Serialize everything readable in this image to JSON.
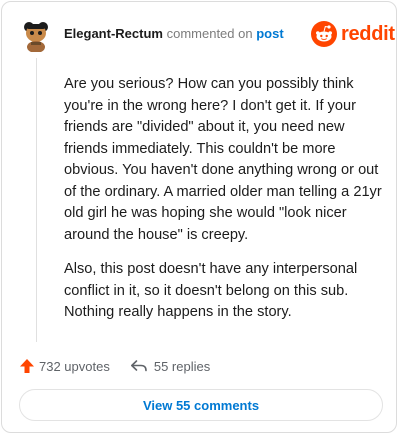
{
  "comment": {
    "username": "Elegant-Rectum",
    "action_text": "commented on",
    "post_link_text": "post",
    "paragraphs": [
      "Are you serious? How can you possibly think you're in the wrong here? I don't get it. If your friends are \"divided\" about it, you need new friends immediately. This couldn't be more obvious. You haven't done anything wrong or out of the ordinary. A married older man telling a 21yr old girl he was hoping she would \"look nicer around the house\" is creepy.",
      "Also, this post doesn't have any interpersonal conflict in it, so it doesn't belong on this sub. Nothing really happens in the story."
    ]
  },
  "brand": {
    "wordmark": "reddit",
    "color": "#ff4500"
  },
  "footer": {
    "upvotes_label": "732 upvotes",
    "replies_label": "55 replies",
    "view_button_label": "View 55 comments"
  },
  "icons": {
    "avatar": "avatar",
    "logo": "reddit-alien-icon",
    "upvote": "upvote-arrow-icon",
    "reply": "reply-arrow-icon"
  },
  "colors": {
    "link": "#0079d3",
    "upvote": "#ff4500",
    "muted": "#7c7c7c"
  }
}
